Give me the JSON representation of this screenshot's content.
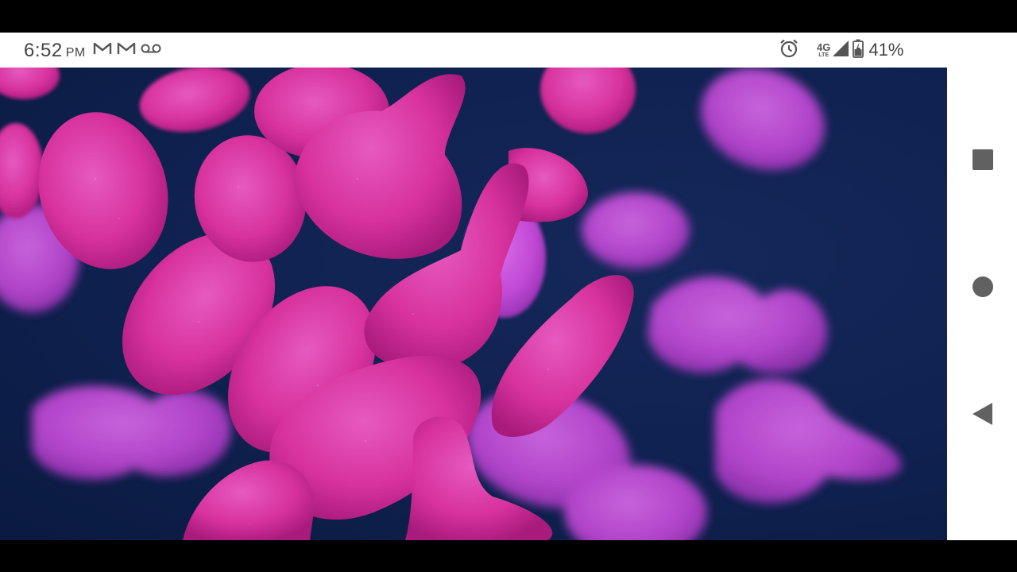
{
  "status_bar": {
    "time": "6:52",
    "ampm": "PM",
    "notification_icons": [
      "gmail-icon",
      "gmail-icon",
      "voicemail-icon"
    ],
    "alarm_icon": "alarm-icon",
    "network_label": "4G",
    "network_sublabel": "LTE",
    "signal_icon": "signal-icon",
    "battery_icon": "battery-charging-icon",
    "battery_percent": "41%"
  },
  "content": {
    "image_subject": "bacteria-image"
  },
  "nav_bar": {
    "buttons": [
      "recents-button",
      "home-button",
      "back-button"
    ]
  },
  "colors": {
    "background": "#0f2150",
    "cell_primary": "#e0309e",
    "cell_secondary": "#c03cd8",
    "status_text": "#444444"
  }
}
